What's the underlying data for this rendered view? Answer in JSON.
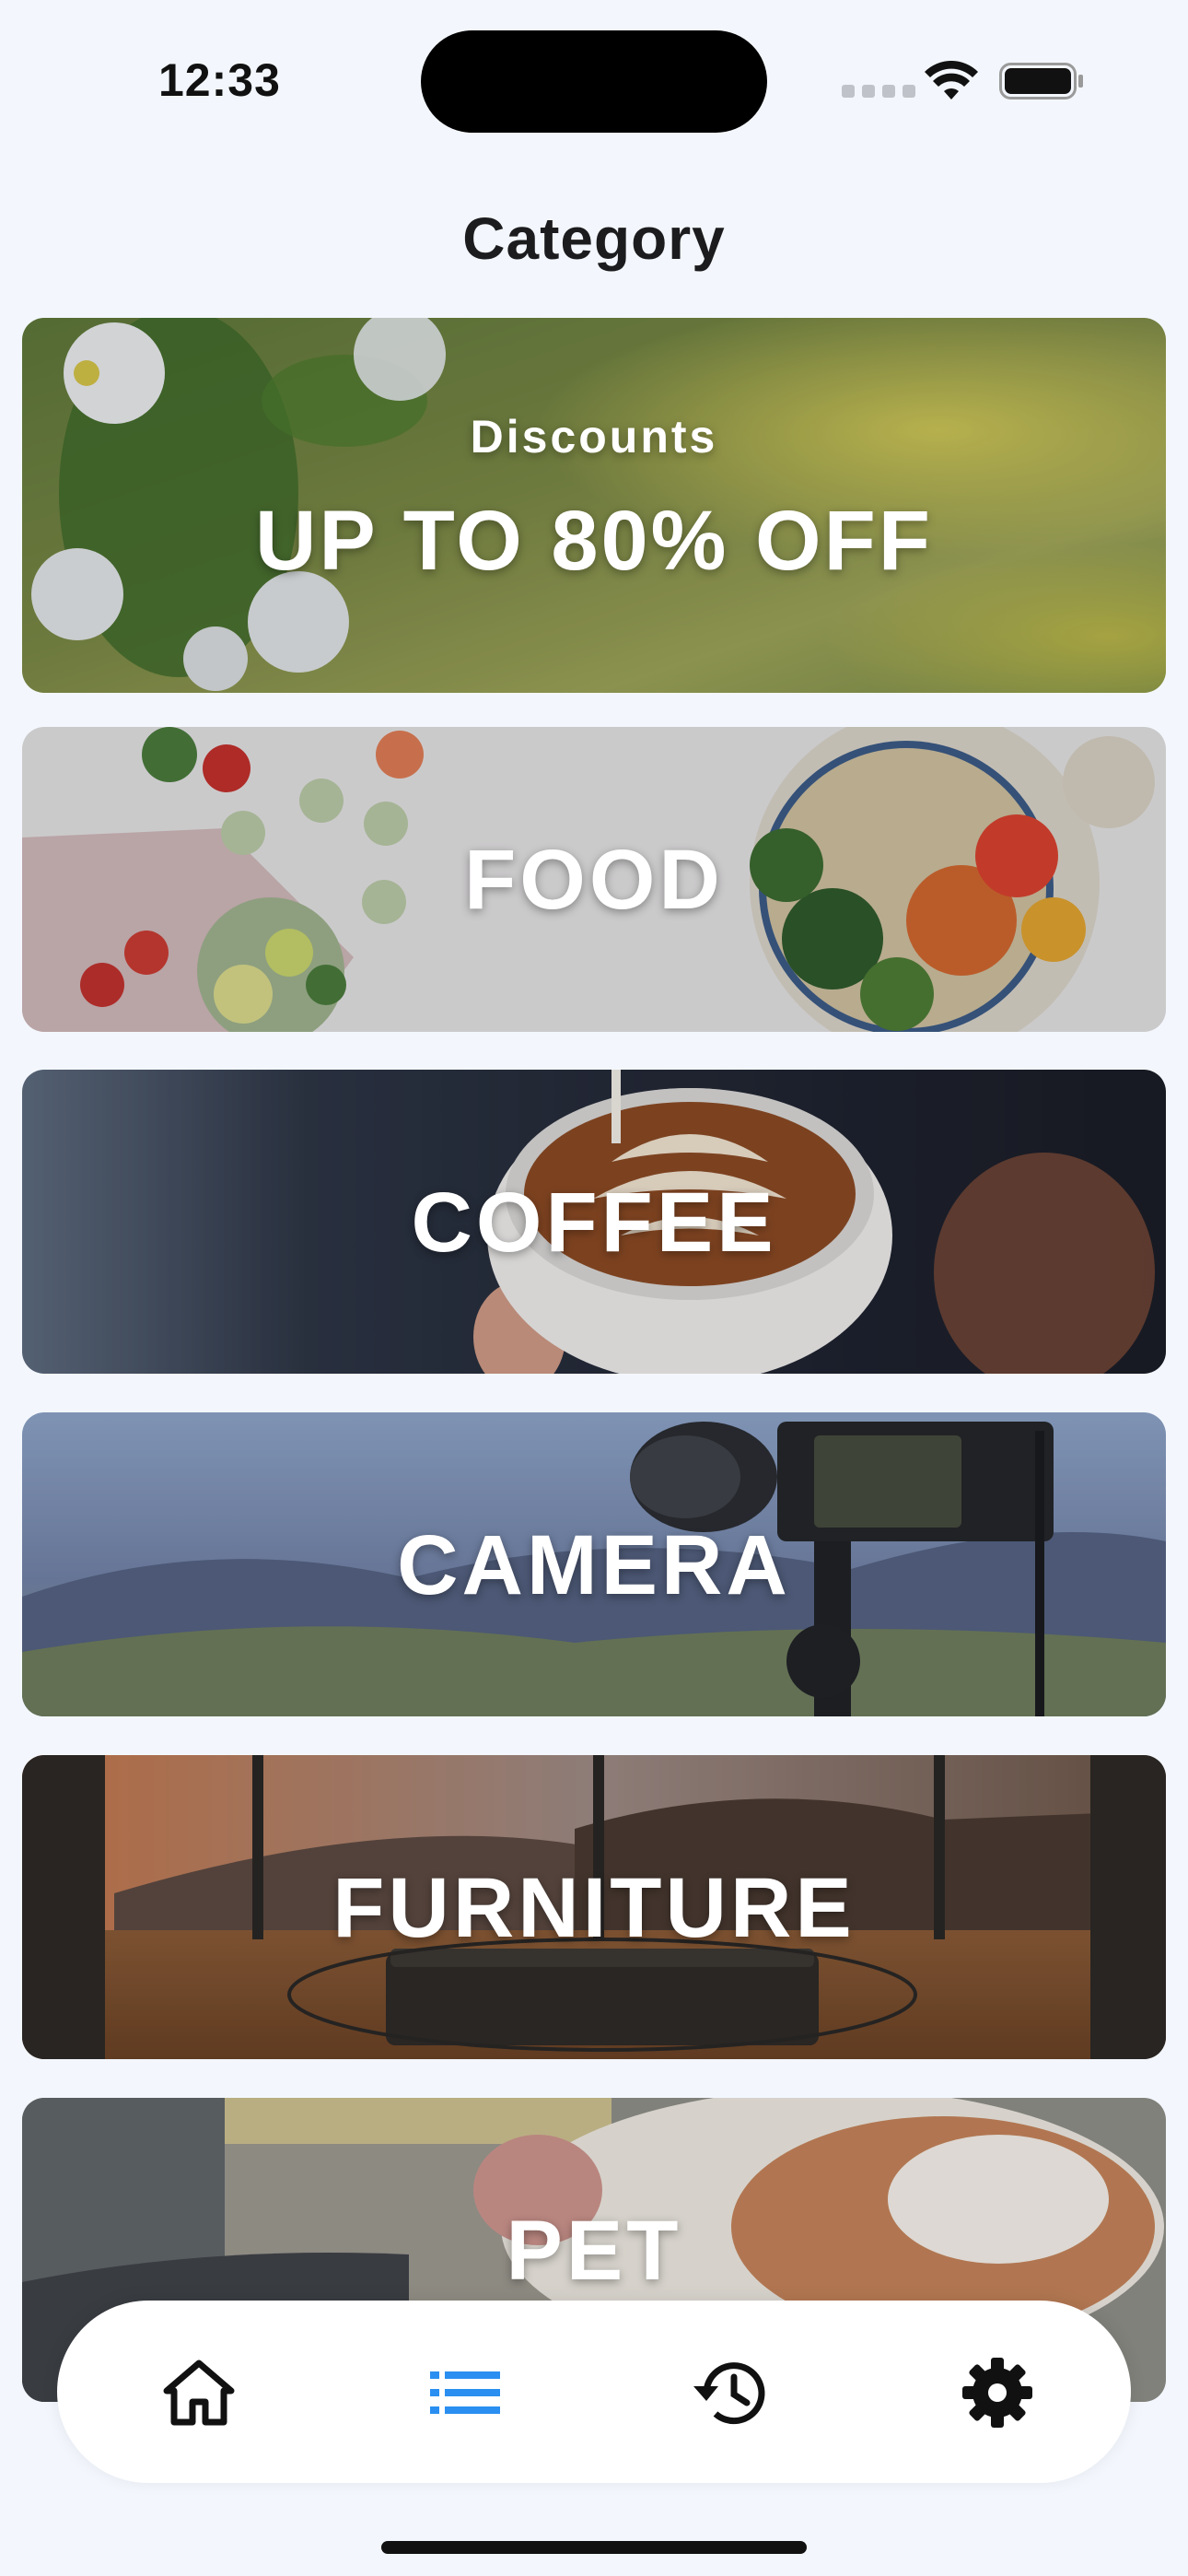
{
  "status_bar": {
    "time": "12:33",
    "icons": [
      "signal-icon",
      "wifi-icon",
      "battery-icon"
    ]
  },
  "page": {
    "title": "Category"
  },
  "banner": {
    "subtitle": "Discounts",
    "headline": "UP TO 80% OFF"
  },
  "categories": [
    {
      "label": "FOOD"
    },
    {
      "label": "COFFEE"
    },
    {
      "label": "CAMERA"
    },
    {
      "label": "FURNITURE"
    },
    {
      "label": "PET"
    }
  ],
  "bottom_nav": {
    "items": [
      {
        "icon": "home-icon",
        "active": false
      },
      {
        "icon": "list-icon",
        "active": true
      },
      {
        "icon": "history-icon",
        "active": false
      },
      {
        "icon": "settings-gear-icon",
        "active": false
      }
    ],
    "active_color": "#2a8ff0",
    "inactive_color": "#111111"
  }
}
